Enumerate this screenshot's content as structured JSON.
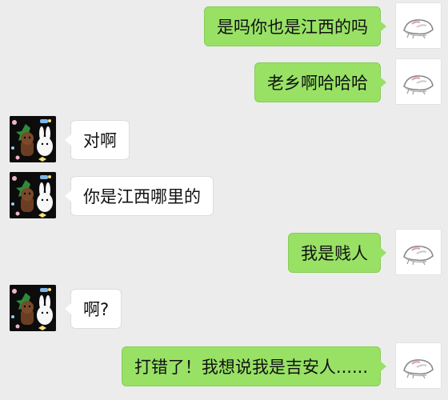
{
  "conversation": {
    "messages": [
      {
        "sender": "me",
        "text": "是吗你也是江西的吗"
      },
      {
        "sender": "me",
        "text": "老乡啊哈哈哈"
      },
      {
        "sender": "friend",
        "text": "对啊"
      },
      {
        "sender": "friend",
        "text": "你是江西哪里的"
      },
      {
        "sender": "me",
        "text": "我是贱人"
      },
      {
        "sender": "friend",
        "text": "啊?"
      },
      {
        "sender": "me",
        "text": "打错了！我想说我是吉安人......"
      }
    ]
  },
  "avatars": {
    "me": {
      "icon": "cartoon-sketch-icon"
    },
    "friend": {
      "icon": "bear-sticker-icon"
    }
  },
  "colors": {
    "background": "#ececec",
    "sent_bubble": "#98e165",
    "received_bubble": "#ffffff"
  }
}
